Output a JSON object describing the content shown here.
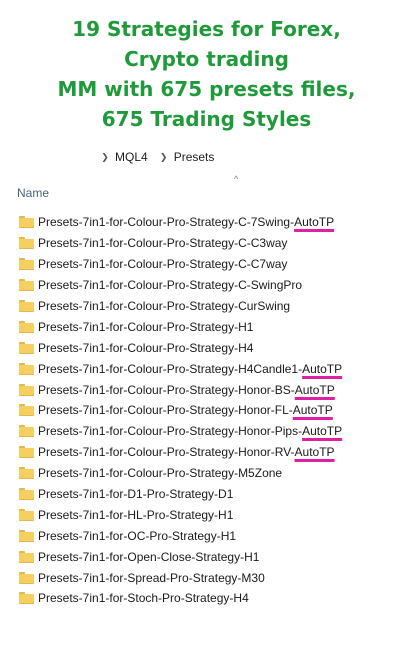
{
  "banner": {
    "lines": [
      "19 Strategies for Forex,",
      "Crypto trading",
      "MM with 675 presets files,",
      "675 Trading Styles"
    ]
  },
  "breadcrumb": {
    "items": [
      "MQL4",
      "Presets"
    ]
  },
  "list_header": {
    "name_label": "Name",
    "sort_indicator": "^"
  },
  "highlight_color": "#e01fa3",
  "title_color": "#1f9a3a",
  "files": [
    {
      "name": "Presets-7in1-for-Colour-Pro-Strategy-C-7Swing-",
      "suffix": "AutoTP",
      "icon": "folder-icon"
    },
    {
      "name": "Presets-7in1-for-Colour-Pro-Strategy-C-C3way",
      "suffix": "",
      "icon": "folder-icon"
    },
    {
      "name": "Presets-7in1-for-Colour-Pro-Strategy-C-C7way",
      "suffix": "",
      "icon": "folder-icon"
    },
    {
      "name": "Presets-7in1-for-Colour-Pro-Strategy-C-SwingPro",
      "suffix": "",
      "icon": "folder-icon"
    },
    {
      "name": "Presets-7in1-for-Colour-Pro-Strategy-CurSwing",
      "suffix": "",
      "icon": "folder-icon"
    },
    {
      "name": "Presets-7in1-for-Colour-Pro-Strategy-H1",
      "suffix": "",
      "icon": "folder-icon"
    },
    {
      "name": "Presets-7in1-for-Colour-Pro-Strategy-H4",
      "suffix": "",
      "icon": "folder-icon"
    },
    {
      "name": "Presets-7in1-for-Colour-Pro-Strategy-H4Candle1-",
      "suffix": "AutoTP",
      "icon": "folder-icon"
    },
    {
      "name": "Presets-7in1-for-Colour-Pro-Strategy-Honor-BS-",
      "suffix": "AutoTP",
      "icon": "folder-icon"
    },
    {
      "name": "Presets-7in1-for-Colour-Pro-Strategy-Honor-FL-",
      "suffix": "AutoTP",
      "icon": "folder-icon"
    },
    {
      "name": "Presets-7in1-for-Colour-Pro-Strategy-Honor-Pips-",
      "suffix": "AutoTP",
      "icon": "folder-icon"
    },
    {
      "name": "Presets-7in1-for-Colour-Pro-Strategy-Honor-RV-",
      "suffix": "AutoTP",
      "icon": "folder-icon"
    },
    {
      "name": "Presets-7in1-for-Colour-Pro-Strategy-M5Zone",
      "suffix": "",
      "icon": "folder-icon"
    },
    {
      "name": "Presets-7in1-for-D1-Pro-Strategy-D1",
      "suffix": "",
      "icon": "folder-icon"
    },
    {
      "name": "Presets-7in1-for-HL-Pro-Strategy-H1",
      "suffix": "",
      "icon": "folder-icon"
    },
    {
      "name": "Presets-7in1-for-OC-Pro-Strategy-H1",
      "suffix": "",
      "icon": "folder-icon"
    },
    {
      "name": "Presets-7in1-for-Open-Close-Strategy-H1",
      "suffix": "",
      "icon": "folder-icon"
    },
    {
      "name": "Presets-7in1-for-Spread-Pro-Strategy-M30",
      "suffix": "",
      "icon": "folder-icon"
    },
    {
      "name": "Presets-7in1-for-Stoch-Pro-Strategy-H4",
      "suffix": "",
      "icon": "folder-icon"
    }
  ]
}
